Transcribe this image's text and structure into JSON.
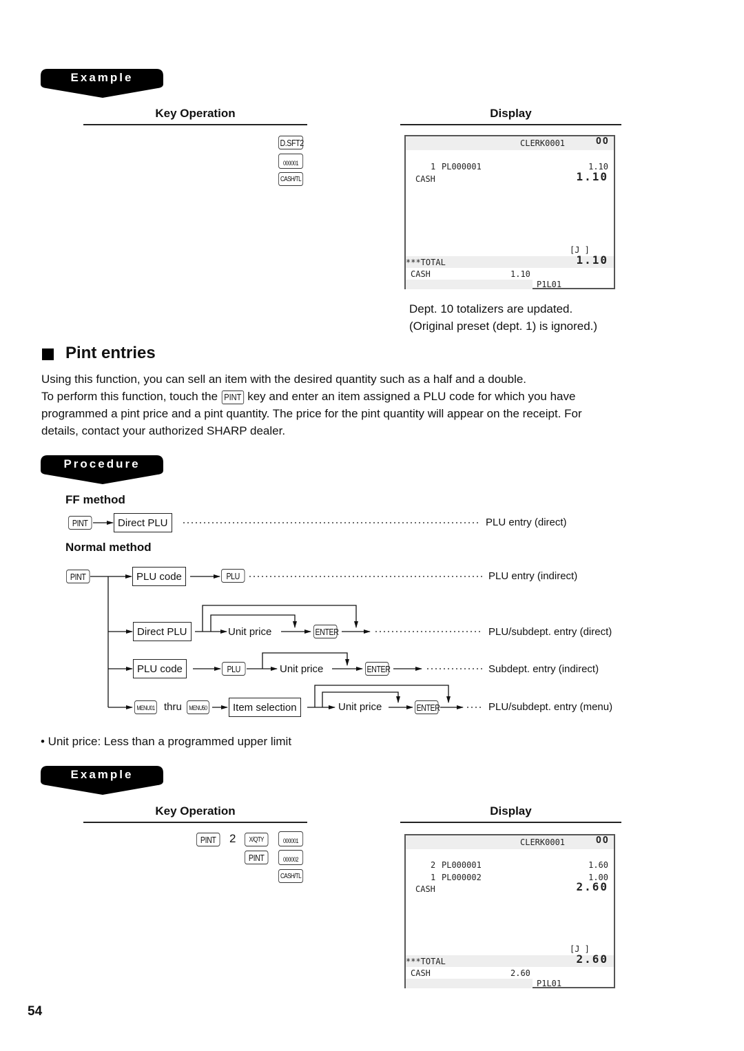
{
  "page_number": "54",
  "example1": {
    "banner": "Example",
    "key_operation_heading": "Key Operation",
    "display_heading": "Display",
    "keys": [
      "D.SFT2",
      "000001",
      "CASH/TL"
    ],
    "display": {
      "clerk": "CLERK0001",
      "status_icon": "OO",
      "lines": [
        {
          "qty": "1",
          "code": "PL000001",
          "amount": "1.10"
        }
      ],
      "cash_label": "CASH",
      "cash_big": "1.10",
      "journal": "[J ]",
      "total_label": "***TOTAL",
      "total_value": "1.10",
      "footer_cash_label": "CASH",
      "footer_cash_value": "1.10",
      "footer_code": "P1L01"
    },
    "notes": [
      "Dept. 10 totalizers are updated.",
      "(Original preset (dept. 1) is ignored.)"
    ]
  },
  "section": {
    "title": "Pint entries",
    "paragraph_line1": "Using this function, you can sell an item with the desired quantity such as a half and a double.",
    "paragraph_line2_before": "To perform this function, touch the",
    "paragraph_key": "PINT",
    "paragraph_line2_after": "key and enter an item assigned a PLU code for which you have",
    "paragraph_line3": "programmed a pint price and a pint quantity. The price for the pint quantity will appear on the receipt. For",
    "paragraph_line4": "details, contact your authorized SHARP dealer."
  },
  "procedure": {
    "banner": "Procedure",
    "ff_method": {
      "heading": "FF method",
      "key": "PINT",
      "box": "Direct PLU",
      "result": "PLU entry (direct)"
    },
    "normal_method": {
      "heading": "Normal method",
      "start_key": "PINT",
      "row1": {
        "box": "PLU code",
        "key": "PLU",
        "result": "PLU entry (indirect)"
      },
      "row2": {
        "box": "Direct PLU",
        "label": "Unit price",
        "key": "ENTER",
        "result": "PLU/subdept. entry (direct)"
      },
      "row3": {
        "box": "PLU code",
        "key1": "PLU",
        "label": "Unit price",
        "key2": "ENTER",
        "result": "Subdept. entry (indirect)"
      },
      "row4": {
        "key_from": "MENU01",
        "thru": "thru",
        "key_to": "MENU50",
        "box": "Item selection",
        "label": "Unit price",
        "key": "ENTER",
        "result": "PLU/subdept. entry (menu)"
      }
    },
    "bullet": "• Unit price: Less than a programmed upper limit"
  },
  "example2": {
    "banner": "Example",
    "key_operation_heading": "Key Operation",
    "display_heading": "Display",
    "keys_row1": [
      "PINT",
      "2",
      "X/QTY",
      "000001"
    ],
    "keys_row2": [
      "PINT",
      "000002"
    ],
    "keys_row3": [
      "CASH/TL"
    ],
    "display": {
      "clerk": "CLERK0001",
      "status_icon": "OO",
      "lines": [
        {
          "qty": "2",
          "code": "PL000001",
          "amount": "1.60"
        },
        {
          "qty": "1",
          "code": "PL000002",
          "amount": "1.00"
        }
      ],
      "cash_label": "CASH",
      "cash_big": "2.60",
      "journal": "[J ]",
      "total_label": "***TOTAL",
      "total_value": "2.60",
      "footer_cash_label": "CASH",
      "footer_cash_value": "2.60",
      "footer_code": "P1L01"
    }
  }
}
